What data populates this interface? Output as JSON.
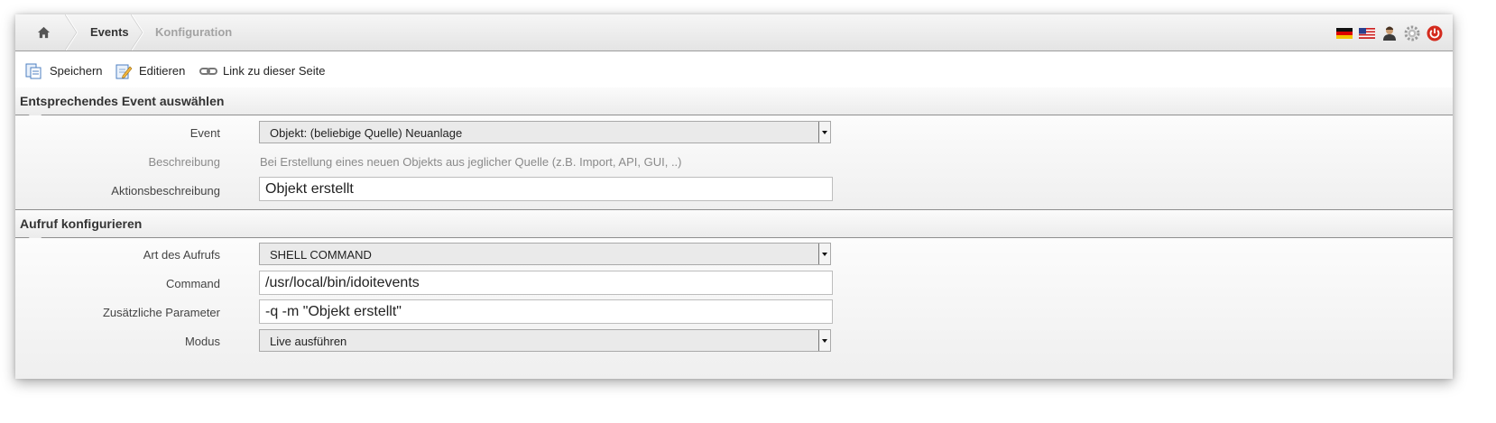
{
  "breadcrumb": {
    "home_icon": "home-icon",
    "items": [
      "Events",
      "Konfiguration"
    ]
  },
  "header_icons": [
    "flag-de-icon",
    "flag-us-icon",
    "user-icon",
    "gear-icon",
    "power-icon"
  ],
  "toolbar": {
    "save_label": "Speichern",
    "edit_label": "Editieren",
    "link_label": "Link zu dieser Seite"
  },
  "section_event": {
    "title": "Entsprechendes Event auswählen",
    "event_label": "Event",
    "event_value": "Objekt: (beliebige Quelle) Neuanlage",
    "description_label": "Beschreibung",
    "description_value": "Bei Erstellung eines neuen Objekts aus jeglicher Quelle (z.B. Import, API, GUI, ..)",
    "action_label": "Aktionsbeschreibung",
    "action_value": "Objekt erstellt"
  },
  "section_call": {
    "title": "Aufruf konfigurieren",
    "type_label": "Art des Aufrufs",
    "type_value": "SHELL COMMAND",
    "command_label": "Command",
    "command_value": "/usr/local/bin/idoitevents",
    "params_label": "Zusätzliche Parameter",
    "params_value": "-q -m \"Objekt erstellt\"",
    "mode_label": "Modus",
    "mode_value": "Live ausführen"
  },
  "colors": {
    "accent_red": "#d42b1e",
    "muted_text": "#8a8a8a",
    "crumb_inactive": "#a3a3a3"
  }
}
